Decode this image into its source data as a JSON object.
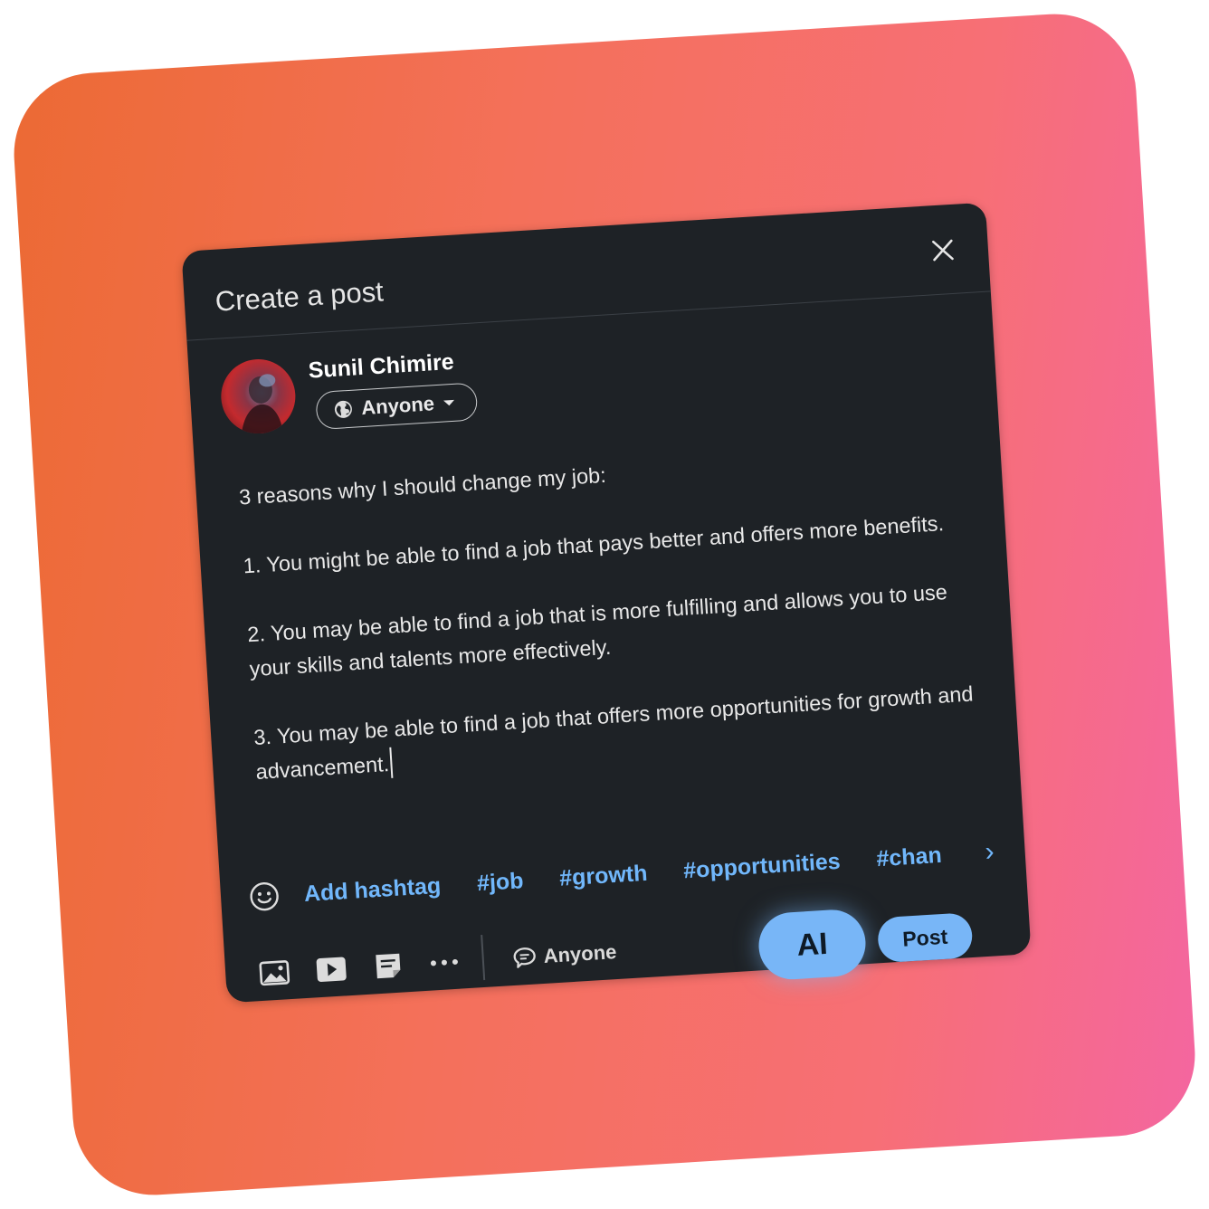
{
  "dialog": {
    "title": "Create a post",
    "close_icon": "close-icon"
  },
  "author": {
    "name": "Sunil Chimire",
    "audience_label": "Anyone"
  },
  "post": {
    "text": "3 reasons why I should change my job:\n\n1. You might be able to find a job that pays better and offers more benefits.\n\n2. You may be able to find a job that is more fulfilling and allows you to use your skills and talents more effectively.\n\n3. You may be able to find a job that offers more opportunities for growth and advancement."
  },
  "hashtags": {
    "add_label": "Add hashtag",
    "suggestions": [
      "#job",
      "#growth",
      "#opportunities",
      "#chan"
    ],
    "next_symbol": "›"
  },
  "toolbar": {
    "comment_setting_label": "Anyone",
    "ai_label": "AI",
    "post_label": "Post"
  },
  "colors": {
    "accent": "#78b6f7",
    "link": "#71b7fb",
    "dialog_bg": "#1e2226"
  }
}
